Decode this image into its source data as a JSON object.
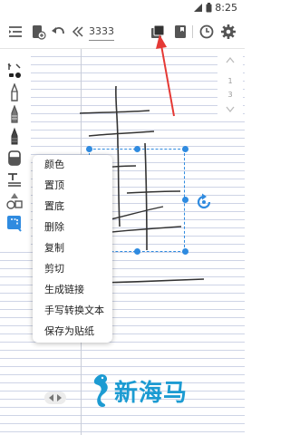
{
  "status_bar": {
    "time": "8:25"
  },
  "toolbar": {
    "page_number": "3333",
    "icons": [
      "menu-icon",
      "notebook-add-icon",
      "undo-icon",
      "collapse-left-icon",
      "layers-icon",
      "book-icon",
      "clock-icon",
      "settings-icon"
    ]
  },
  "page_nav": {
    "current": "1",
    "total": "3"
  },
  "tools": [
    "pen-select-icon",
    "pen-icon",
    "fountain-pen-icon",
    "marker-icon",
    "eraser-icon",
    "text-icon",
    "shapes-icon",
    "lasso-icon"
  ],
  "context_menu": {
    "items": [
      "颜色",
      "置顶",
      "置底",
      "删除",
      "复制",
      "剪切",
      "生成链接",
      "手写转换文本",
      "保存为贴纸"
    ]
  },
  "watermark": {
    "text": "新海马"
  },
  "colors": {
    "accent": "#2f8be0",
    "arrow": "#e53935",
    "watermark": "#1c9bd2"
  }
}
